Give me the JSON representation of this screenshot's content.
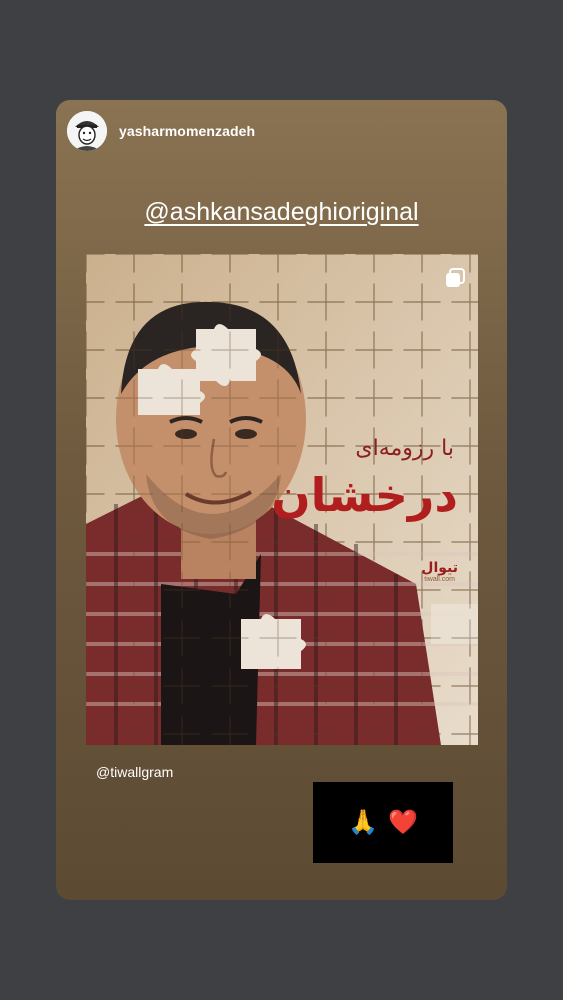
{
  "story": {
    "username": "yasharmomenzadeh",
    "mention": "@ashkansadeghioriginal",
    "tag": "@tiwallgram",
    "reply_emojis": [
      "🙏",
      "❤️"
    ]
  },
  "post": {
    "title_small": "با رزومه‌ای",
    "title_large": "درخشان",
    "logo_text": "تیوال",
    "logo_sub": "tiwall.com"
  },
  "icons": {
    "avatar": "cartoon-avatar",
    "multi_post": "carousel-icon"
  },
  "colors": {
    "page_background": "#3e4043",
    "story_top": "#8a7352",
    "story_bottom": "#5c4a33",
    "title_red": "#b01e1e"
  }
}
